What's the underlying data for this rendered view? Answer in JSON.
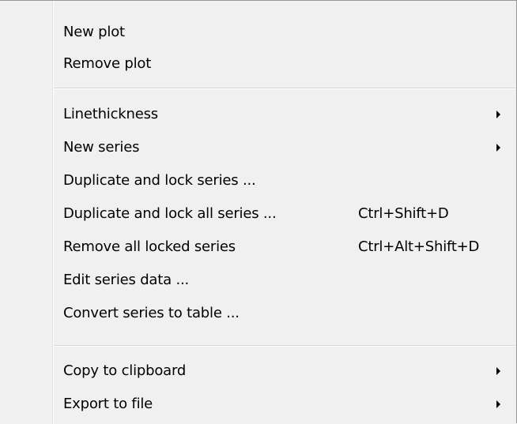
{
  "menu": {
    "items": [
      {
        "label": "New plot"
      },
      {
        "label": "Remove plot"
      },
      {
        "label": "Linethickness"
      },
      {
        "label": "New series"
      },
      {
        "label": "Duplicate and lock series ..."
      },
      {
        "label": "Duplicate and lock all series ...",
        "shortcut": "Ctrl+Shift+D"
      },
      {
        "label": "Remove all locked series",
        "shortcut": "Ctrl+Alt+Shift+D"
      },
      {
        "label": "Edit series data ..."
      },
      {
        "label": "Convert series to table ..."
      },
      {
        "label": "Copy to clipboard"
      },
      {
        "label": "Export to file"
      }
    ],
    "submenu_arrow_icon": "chevron-right-icon"
  }
}
